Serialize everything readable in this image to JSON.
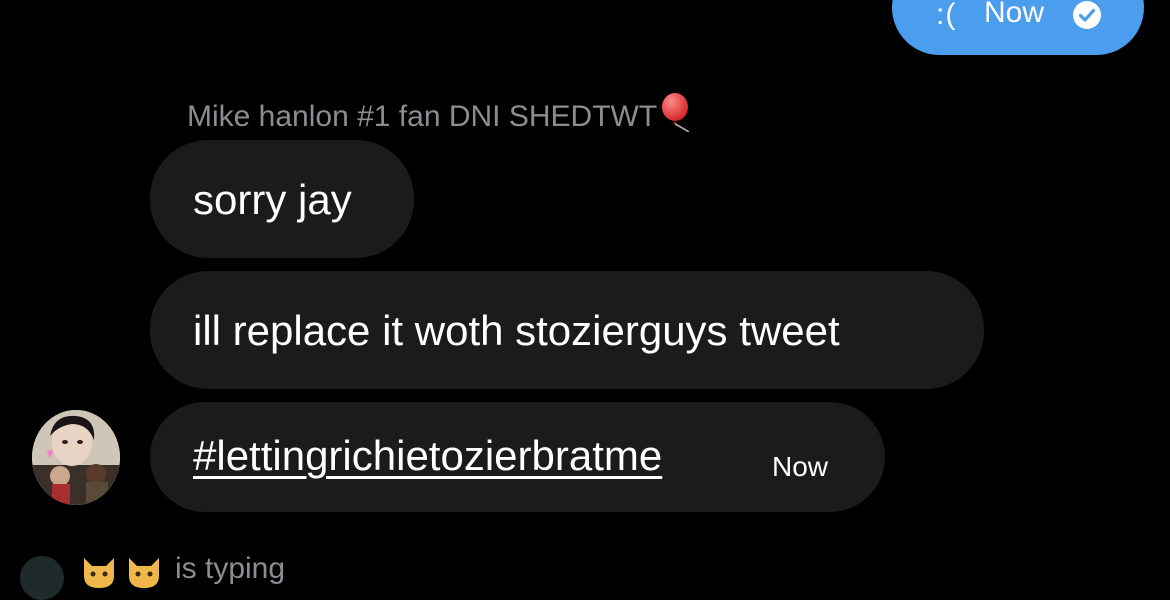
{
  "colors": {
    "background": "#000000",
    "sent_bubble": "#4a9eed",
    "received_bubble": "#1a1b1d",
    "secondary_text": "#8a8d91"
  },
  "sent_message": {
    "text": ":(",
    "time": "Now",
    "status_icon": "read-check-icon"
  },
  "sender": {
    "name": "Mike hanlon #1 fan DNI SHEDTWT",
    "name_icon": "balloon-icon"
  },
  "messages": [
    {
      "text": "sorry jay"
    },
    {
      "text": "ill replace it woth stozierguys tweet"
    },
    {
      "text": "#lettingrichietozierbratme",
      "time": "Now",
      "is_hashtag": true
    }
  ],
  "typing_indicator": {
    "text": "is typing",
    "icons": [
      "cat-face-icon",
      "cat-face-icon"
    ]
  }
}
